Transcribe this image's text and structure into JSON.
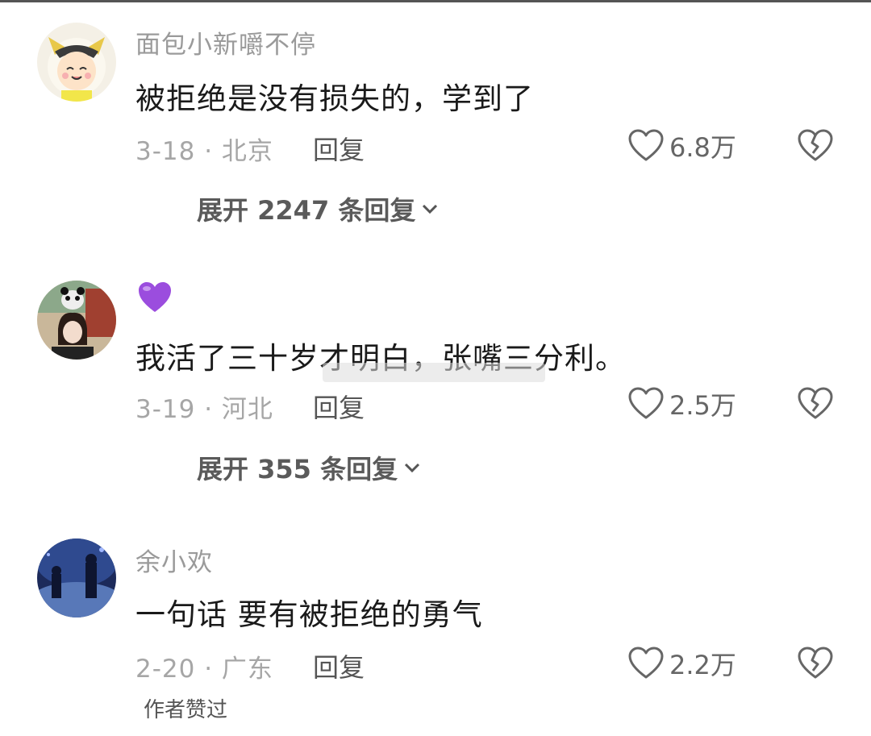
{
  "comments": [
    {
      "username": "面包小新嚼不停",
      "text": "被拒绝是没有损失的，学到了",
      "meta": "3-18 · 北京",
      "reply_label": "回复",
      "likes": "6.8万",
      "expand_label": "展开 2247 条回复"
    },
    {
      "username": "",
      "username_icon": "purple-heart-icon",
      "text": "我活了三十岁才明白，张嘴三分利。",
      "meta": "3-19 · 河北",
      "reply_label": "回复",
      "likes": "2.5万",
      "expand_label": "展开 355 条回复"
    },
    {
      "username": "余小欢",
      "text": "一句话 要有被拒绝的勇气",
      "meta": "2-20 · 广东",
      "reply_label": "回复",
      "likes": "2.2万",
      "author_liked": "作者赞过"
    }
  ],
  "colors": {
    "username": "#9a9a9a",
    "text": "#1a1a1a",
    "meta": "#a6a6a6",
    "purple_heart": "#9b4dde"
  }
}
